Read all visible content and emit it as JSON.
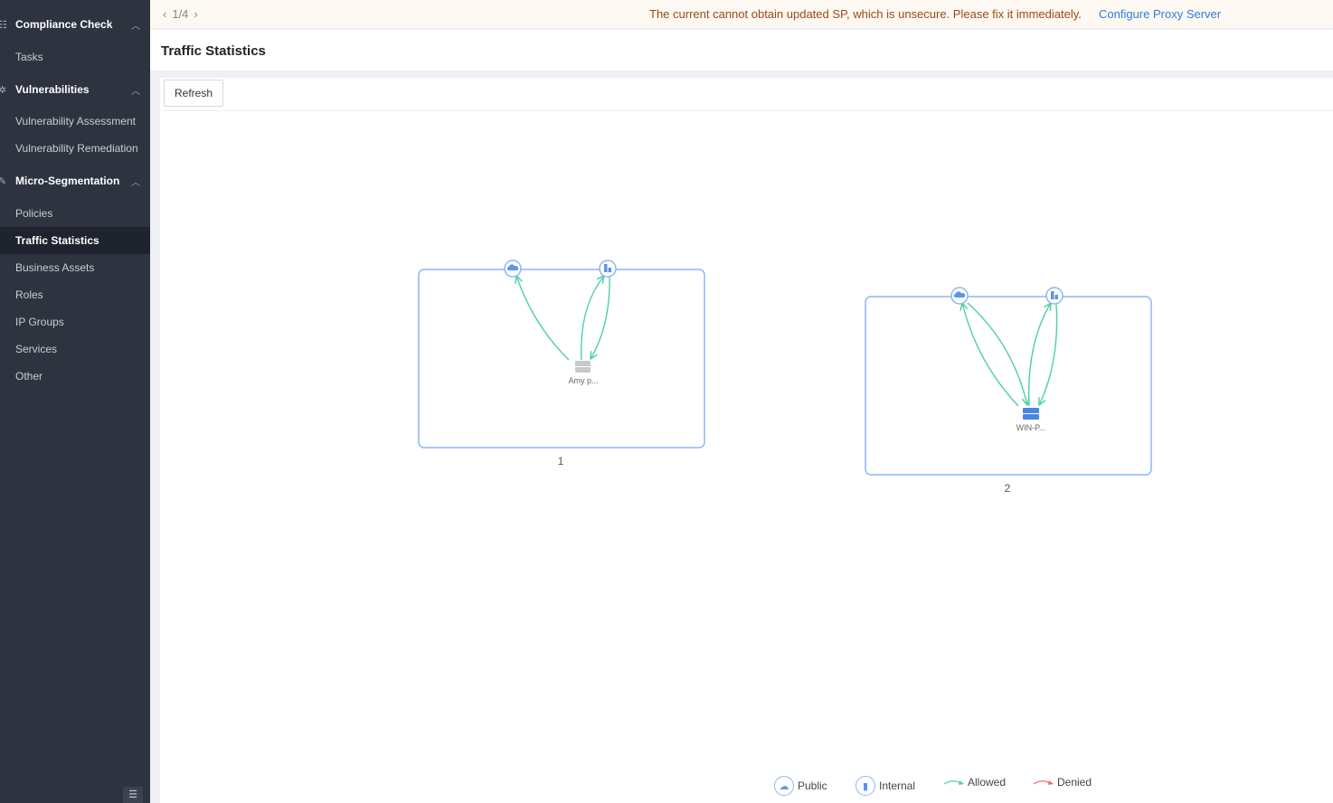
{
  "sidebar": {
    "groups": [
      {
        "label": "Compliance Check",
        "icon": "list-icon"
      },
      {
        "label": "Vulnerabilities",
        "icon": "bug-icon"
      },
      {
        "label": "Micro-Segmentation",
        "icon": "segment-icon"
      }
    ],
    "items": [
      "Tasks",
      "Vulnerability Assessment",
      "Vulnerability Remediation",
      "Policies",
      "Traffic Statistics",
      "Business Assets",
      "Roles",
      "IP Groups",
      "Services",
      "Other"
    ],
    "active": "Traffic Statistics"
  },
  "banner": {
    "pager": "1/4",
    "message": "The current cannot obtain updated SP, which is unsecure. Please fix it immediately.",
    "link": "Configure Proxy Server"
  },
  "header": {
    "title": "Traffic Statistics"
  },
  "toolbar": {
    "refresh": "Refresh"
  },
  "groups": [
    {
      "label": "1",
      "host": "Amy p...",
      "host_status": "offline"
    },
    {
      "label": "2",
      "host": "WIN-P...",
      "host_status": "online"
    }
  ],
  "legend": {
    "public": "Public",
    "internal": "Internal",
    "allowed": "Allowed",
    "denied": "Denied"
  },
  "colors": {
    "allowed": "#4fd1a0",
    "denied": "#f46b6b",
    "node": "#5b95ee",
    "box": "#8db6f5",
    "sidebar": "#2e3340"
  }
}
